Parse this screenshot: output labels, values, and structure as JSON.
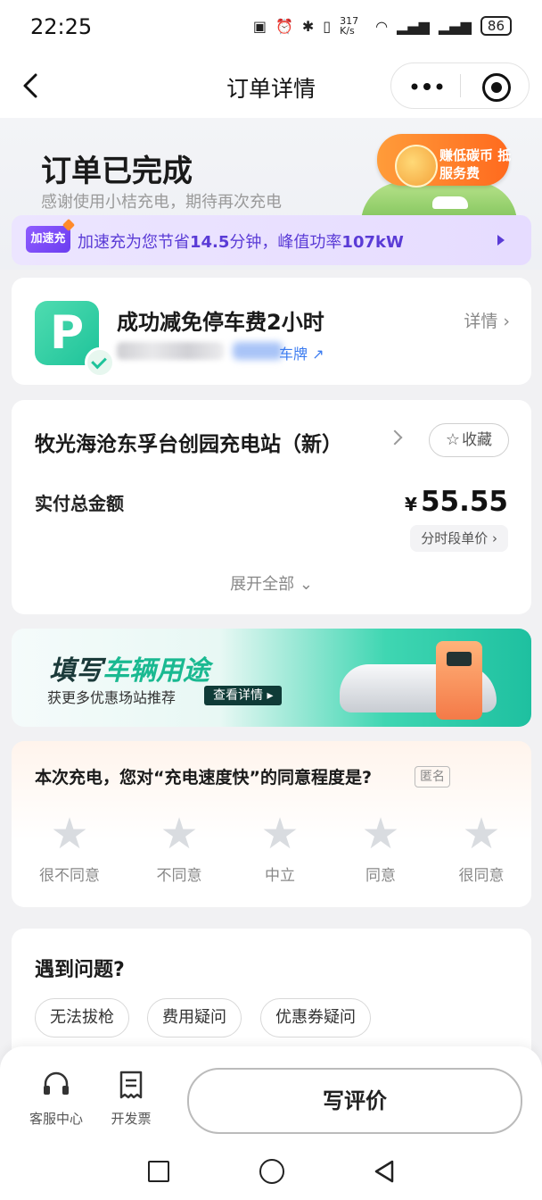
{
  "status_bar": {
    "time": "22:25",
    "net_speed": "317 K/s",
    "signal_badge": "6",
    "battery": "86"
  },
  "nav": {
    "title": "订单详情"
  },
  "hero": {
    "title": "订单已完成",
    "subtitle": "感谢使用小桔充电，期待再次充电",
    "promo_text": "赚低碳币 抵服务费"
  },
  "speed_tip": {
    "badge": "加速充",
    "prefix": "加速充为您节省",
    "saved": "14.5",
    "mid": "分钟，峰值功率",
    "power": "107kW"
  },
  "parking": {
    "icon_letter": "P",
    "title": "成功减免停车费2小时",
    "plate_link": "车牌",
    "detail": "详情"
  },
  "station": {
    "name": "牧光海沧东孚台创园充电站（新）",
    "favorite": "收藏",
    "total_label": "实付总金额",
    "currency": "¥",
    "total": "55.55",
    "unit_price": "分时段单价",
    "expand": "展开全部"
  },
  "banner": {
    "title_plain": "填写",
    "title_highlight": "车辆用途",
    "subtitle": "获更多优惠场站推荐",
    "button": "查看详情"
  },
  "survey": {
    "question": "本次充电，您对“充电速度快”的同意程度是?",
    "anonymous": "匿名",
    "options": [
      "很不同意",
      "不同意",
      "中立",
      "同意",
      "很同意"
    ]
  },
  "issues": {
    "title": "遇到问题?",
    "chips": [
      "无法拔枪",
      "费用疑问",
      "优惠券疑问"
    ]
  },
  "bottom": {
    "service": "客服中心",
    "invoice": "开发票",
    "review": "写评价"
  },
  "colors": {
    "accent_green": "#1ec39a",
    "speed_purple": "#5a3bd6",
    "promo_orange": "#ff7a2a"
  }
}
